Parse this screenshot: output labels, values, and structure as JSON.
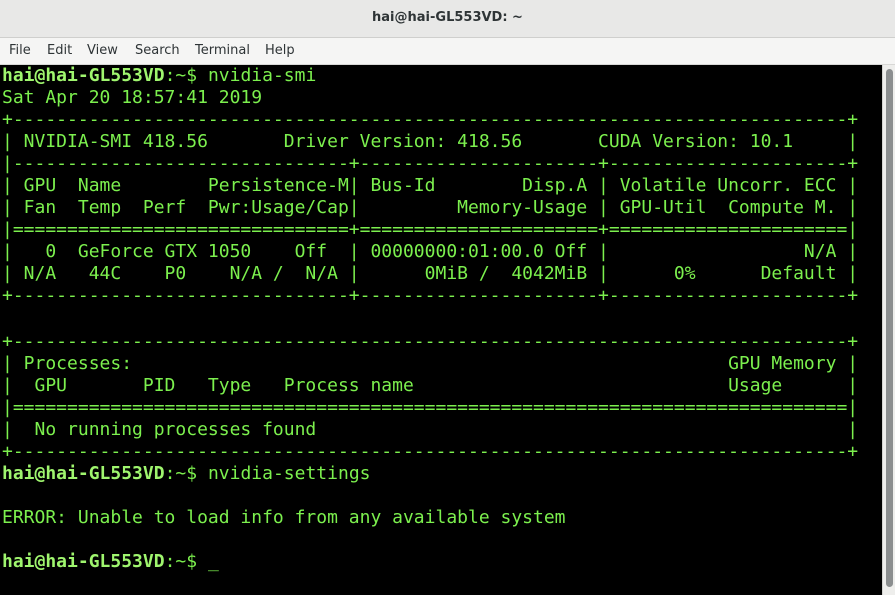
{
  "window": {
    "title": "hai@hai-GL553VD: ~"
  },
  "menu": [
    "File",
    "Edit",
    "View",
    "Search",
    "Terminal",
    "Help"
  ],
  "prompt": {
    "user": "hai@hai-GL553VD",
    "path": ":~",
    "symbol": "$ "
  },
  "terminal": {
    "cmd1": "nvidia-smi",
    "date": "Sat Apr 20 18:57:41 2019",
    "smi": [
      "+-----------------------------------------------------------------------------+",
      "| NVIDIA-SMI 418.56       Driver Version: 418.56       CUDA Version: 10.1     |",
      "|-------------------------------+----------------------+----------------------+",
      "| GPU  Name        Persistence-M| Bus-Id        Disp.A | Volatile Uncorr. ECC |",
      "| Fan  Temp  Perf  Pwr:Usage/Cap|         Memory-Usage | GPU-Util  Compute M. |",
      "|===============================+======================+======================|",
      "|   0  GeForce GTX 1050    Off  | 00000000:01:00.0 Off |                  N/A |",
      "| N/A   44C    P0    N/A /  N/A |      0MiB /  4042MiB |      0%      Default |",
      "+-------------------------------+----------------------+----------------------+",
      "",
      "",
      "+-----------------------------------------------------------------------------+",
      "| Processes:                                                       GPU Memory |",
      "|  GPU       PID   Type   Process name                             Usage      |",
      "|=============================================================================|",
      "|  No running processes found                                                 |",
      "+-----------------------------------------------------------------------------+"
    ],
    "cmd2": "nvidia-settings",
    "blank": "",
    "error": "ERROR: Unable to load info from any available system",
    "cursor": "_"
  }
}
